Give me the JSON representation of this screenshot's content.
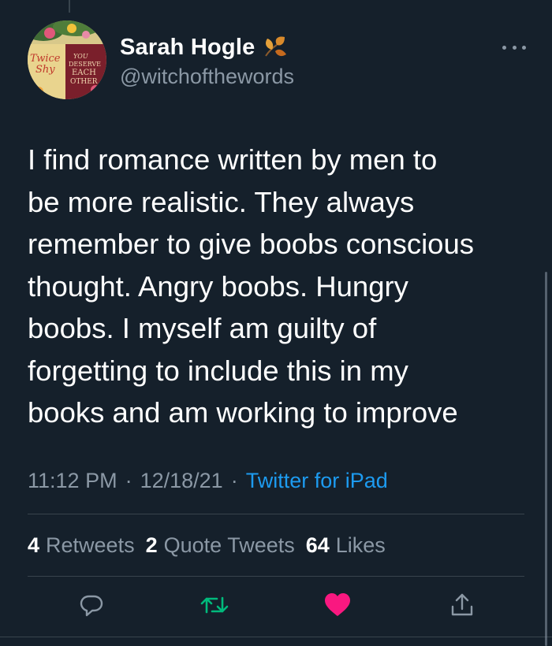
{
  "tweet": {
    "display_name": "Sarah Hogle",
    "handle": "@witchofthewords",
    "text": "I find romance written by men to\nbe more realistic. They always\nremember to give boobs conscious\nthought. Angry boobs. Hungry\nboobs. I myself am guilty of\nforgetting to include this in my\nbooks and am working to improve",
    "time": "11:12 PM",
    "date": "12/18/21",
    "separator": "·",
    "source": "Twitter for iPad"
  },
  "avatar": {
    "book1_text": "Twice Shy",
    "book2_text": "YOU DESERVE EACH OTHER"
  },
  "stats": {
    "retweets_count": "4",
    "retweets_label": "Retweets",
    "quote_tweets_count": "2",
    "quote_tweets_label": "Quote Tweets",
    "likes_count": "64",
    "likes_label": "Likes"
  },
  "icons": {
    "name_badge": "autumn-leaf-icon",
    "more": "more-dots-icon",
    "reply": "reply-icon",
    "retweet": "retweet-icon",
    "like": "heart-icon",
    "share": "share-icon"
  },
  "colors": {
    "background": "#15202b",
    "text_primary": "#ffffff",
    "text_secondary": "#8b98a5",
    "link": "#1d9bf0",
    "retweet_active": "#00ba7c",
    "like_active": "#f91880",
    "divider": "#38444d"
  }
}
